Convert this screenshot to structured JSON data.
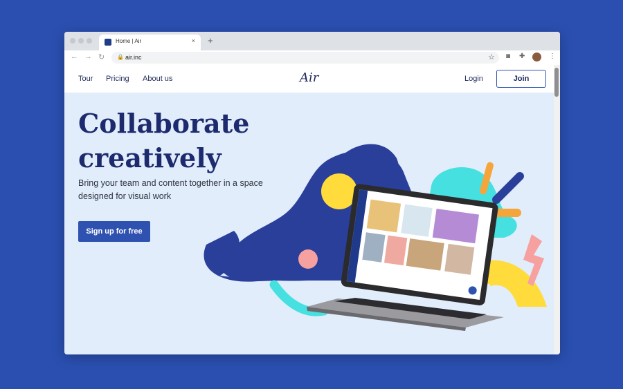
{
  "browser": {
    "tab_title": "Home | Air",
    "tab_close": "×",
    "new_tab": "+",
    "url": "air.inc",
    "icons": [
      "back-icon",
      "forward-icon",
      "reload-icon",
      "lock-icon",
      "star-icon",
      "camera-icon",
      "extensions-icon",
      "profile-avatar",
      "menu-icon"
    ]
  },
  "site": {
    "nav": {
      "tour": "Tour",
      "pricing": "Pricing",
      "about": "About us"
    },
    "logo": "Air",
    "login": "Login",
    "join": "Join",
    "hero": {
      "line1": "Collaborate",
      "line2": "creatively",
      "subtext": "Bring your team and content together in a space designed for visual work",
      "cta": "Sign up for free"
    }
  },
  "colors": {
    "background": "#2a4fb0",
    "hero_bg": "#e1edfa",
    "headline": "#1d2a6e",
    "primary": "#2f52b0",
    "blob_navy": "#2a3f9a",
    "teal": "#46e0e0",
    "yellow": "#ffdb3b",
    "pink": "#f6a0a0",
    "orange": "#f6a53a"
  }
}
